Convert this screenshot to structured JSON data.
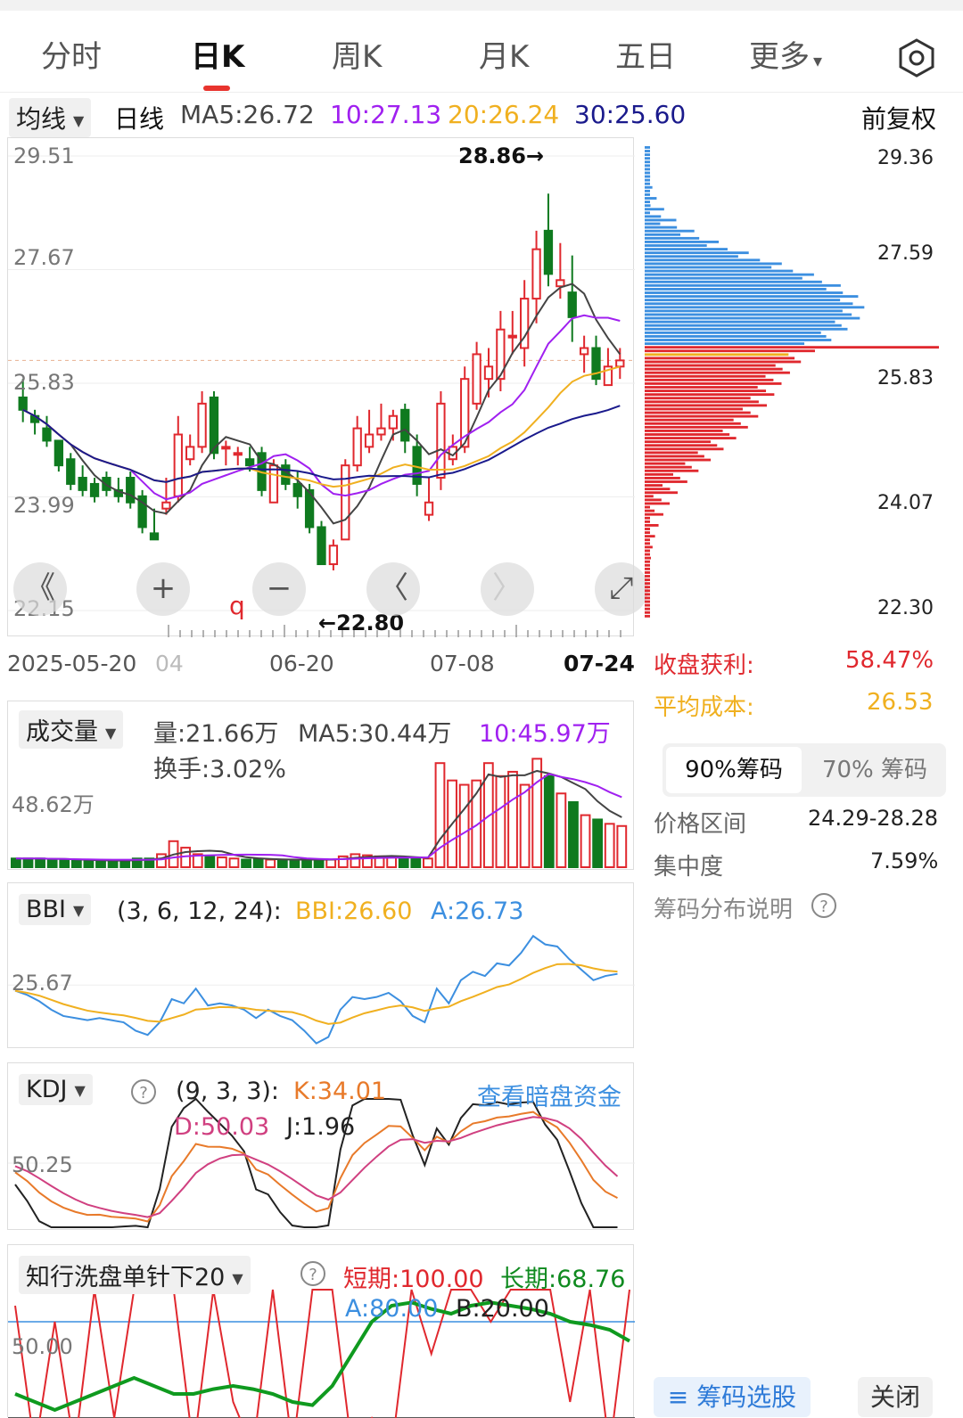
{
  "tabs": [
    "分时",
    "日K",
    "周K",
    "月K",
    "五日",
    "更多"
  ],
  "tab_more_caret": "▾",
  "ma_bar": {
    "dropdown": "均线",
    "period": "日线",
    "ma5": "MA5:26.72",
    "ma10": "10:27.13",
    "ma20": "20:26.24",
    "ma30": "30:25.60",
    "adjust": "前复权"
  },
  "colors": {
    "up": "#e0282e",
    "down": "#0f7a1f",
    "ma5": "#444444",
    "ma10": "#a020f0",
    "ma20": "#f0b020",
    "ma30": "#1a1a8c",
    "blue": "#3c8fe0"
  },
  "kline": {
    "y_labels": [
      "29.51",
      "27.67",
      "25.83",
      "23.99",
      "22.15"
    ],
    "high_marker": "28.86→",
    "low_marker": "←22.80",
    "dates": [
      "2025-05-20",
      "04",
      "06-20",
      "07-08",
      "07-24"
    ],
    "controls": [
      "《",
      "+",
      "−",
      "〈",
      "〉",
      "⤢"
    ]
  },
  "chips": {
    "prices": [
      "29.36",
      "27.59",
      "25.83",
      "24.07",
      "22.30"
    ],
    "profit_label": "收盘获利:",
    "profit_value": "58.47%",
    "avg_cost_label": "平均成本:",
    "avg_cost_value": "26.53",
    "tab90": "90%筹码",
    "tab70": "70% 筹码",
    "range_label": "价格区间",
    "range_value": "24.29-28.28",
    "conc_label": "集中度",
    "conc_value": "7.59%",
    "explain": "筹码分布说明",
    "select_btn": "筹码选股",
    "close_btn": "关闭"
  },
  "volume": {
    "dropdown": "成交量",
    "vol": "量:21.66万",
    "ma5": "MA5:30.44万",
    "ma10": "10:45.97万",
    "turnover": "换手:3.02%",
    "y_label": "48.62万"
  },
  "bbi": {
    "dropdown": "BBI",
    "params": "(3, 6, 12, 24):",
    "bbi": "BBI:26.60",
    "a": "A:26.73",
    "y_label": "25.67"
  },
  "kdj": {
    "dropdown": "KDJ",
    "params": "(9, 3, 3):",
    "k": "K:34.01",
    "d": "D:50.03",
    "j": "J:1.96",
    "link": "查看暗盘资金",
    "y_label": "50.25"
  },
  "zx": {
    "dropdown": "知行洗盘单针下20",
    "short": "短期:100.00",
    "long": "长期:68.76",
    "a": "A:80.00",
    "b": "B:20.00",
    "y_label": "50.00"
  },
  "chart_data": [
    {
      "type": "candlestick",
      "title": "日K",
      "ylim": [
        22.15,
        29.51
      ],
      "candles": [
        [
          25.6,
          25.9,
          25.4,
          25.2
        ],
        [
          25.3,
          25.4,
          25.2,
          25.0
        ],
        [
          25.1,
          25.3,
          24.9,
          24.8
        ],
        [
          24.9,
          24.9,
          24.5,
          24.4
        ],
        [
          24.6,
          24.7,
          24.2,
          24.1
        ],
        [
          24.3,
          24.5,
          24.1,
          24.0
        ],
        [
          24.2,
          24.3,
          24.0,
          23.9
        ],
        [
          24.3,
          24.4,
          24.1,
          24.0
        ],
        [
          24.1,
          24.3,
          24.0,
          23.9
        ],
        [
          24.3,
          24.4,
          23.9,
          23.8
        ],
        [
          24.0,
          24.1,
          23.5,
          23.4
        ],
        [
          23.4,
          23.8,
          23.3,
          23.3
        ],
        [
          23.8,
          24.3,
          23.9,
          23.7
        ],
        [
          24.0,
          25.3,
          25.0,
          23.9
        ],
        [
          24.6,
          25.0,
          24.8,
          24.5
        ],
        [
          24.8,
          25.7,
          25.5,
          24.7
        ],
        [
          25.6,
          25.7,
          24.7,
          24.6
        ],
        [
          24.8,
          24.9,
          24.8,
          24.5
        ],
        [
          24.7,
          24.8,
          24.7,
          24.5
        ],
        [
          24.6,
          24.8,
          24.5,
          24.4
        ],
        [
          24.7,
          24.8,
          24.1,
          24.0
        ],
        [
          23.9,
          24.6,
          24.5,
          23.9
        ],
        [
          24.5,
          24.6,
          24.2,
          24.1
        ],
        [
          24.2,
          24.4,
          24.0,
          23.8
        ],
        [
          24.1,
          24.2,
          23.5,
          23.4
        ],
        [
          23.5,
          23.6,
          22.9,
          22.9
        ],
        [
          22.9,
          23.3,
          23.2,
          22.8
        ],
        [
          23.3,
          24.6,
          24.5,
          23.3
        ],
        [
          24.5,
          25.3,
          25.1,
          24.4
        ],
        [
          24.8,
          25.4,
          25.0,
          24.7
        ],
        [
          25.0,
          25.5,
          25.1,
          24.9
        ],
        [
          25.1,
          25.4,
          25.3,
          24.9
        ],
        [
          25.4,
          25.5,
          24.9,
          24.7
        ],
        [
          24.8,
          25.0,
          24.2,
          24.0
        ],
        [
          23.7,
          24.3,
          23.9,
          23.6
        ],
        [
          24.3,
          25.7,
          25.5,
          24.1
        ],
        [
          24.6,
          25.0,
          24.8,
          24.5
        ],
        [
          24.8,
          26.1,
          25.9,
          24.7
        ],
        [
          25.5,
          26.5,
          26.3,
          25.4
        ],
        [
          25.9,
          26.4,
          26.1,
          25.6
        ],
        [
          25.9,
          27.0,
          26.7,
          25.7
        ],
        [
          26.6,
          27.0,
          26.6,
          26.3
        ],
        [
          26.4,
          27.5,
          27.2,
          26.1
        ],
        [
          27.2,
          28.3,
          28.0,
          26.8
        ],
        [
          28.3,
          28.9,
          27.6,
          27.4
        ],
        [
          27.4,
          28.1,
          27.5,
          27.2
        ],
        [
          27.3,
          27.9,
          26.9,
          26.5
        ],
        [
          26.3,
          26.6,
          26.4,
          26.0
        ],
        [
          26.4,
          26.6,
          25.9,
          25.8
        ],
        [
          25.8,
          26.4,
          26.1,
          25.8
        ],
        [
          26.1,
          26.4,
          26.2,
          25.9
        ]
      ],
      "ma5_label": "MA5:26.72",
      "ma10_label": "10:27.13",
      "ma20_label": "20:26.24",
      "ma30_label": "30:25.60"
    },
    {
      "type": "bar",
      "title": "成交量",
      "ylim": [
        0,
        60
      ],
      "values": [
        4,
        4,
        4,
        3.5,
        3.5,
        3,
        3,
        3,
        3,
        3.2,
        4,
        4,
        6,
        12,
        9,
        6,
        5,
        4.5,
        4,
        3.5,
        3.5,
        3.5,
        3.5,
        3.5,
        3.5,
        3.5,
        3.5,
        5,
        6,
        5.5,
        5,
        4.5,
        4,
        4,
        4,
        48,
        40,
        38,
        40,
        48,
        42,
        44,
        38,
        50,
        42,
        34,
        30,
        24,
        22,
        20,
        19
      ]
    }
  ]
}
